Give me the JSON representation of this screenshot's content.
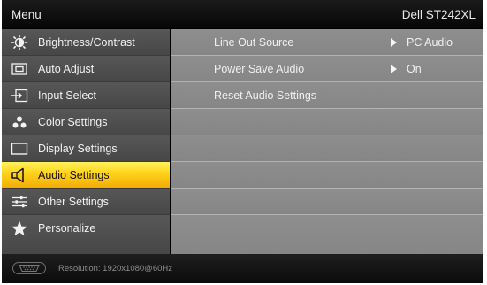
{
  "header": {
    "title": "Menu",
    "model": "Dell ST242XL"
  },
  "sidebar": {
    "items": [
      {
        "label": "Brightness/Contrast",
        "icon": "brightness-icon",
        "active": false
      },
      {
        "label": "Auto Adjust",
        "icon": "auto-adjust-icon",
        "active": false
      },
      {
        "label": "Input Select",
        "icon": "input-select-icon",
        "active": false
      },
      {
        "label": "Color Settings",
        "icon": "color-settings-icon",
        "active": false
      },
      {
        "label": "Display Settings",
        "icon": "display-settings-icon",
        "active": false
      },
      {
        "label": "Audio Settings",
        "icon": "speaker-icon",
        "active": true
      },
      {
        "label": "Other Settings",
        "icon": "other-settings-icon",
        "active": false
      },
      {
        "label": "Personalize",
        "icon": "star-icon",
        "active": false
      }
    ]
  },
  "content": {
    "rows": [
      {
        "label": "Line Out Source",
        "value": "PC Audio"
      },
      {
        "label": "Power Save Audio",
        "value": "On"
      },
      {
        "label": "Reset Audio Settings",
        "value": ""
      }
    ]
  },
  "footer": {
    "resolution": "Resolution:  1920x1080@60Hz",
    "input_icon": "vga-connector-icon"
  },
  "colors": {
    "highlight": "#ffd21a",
    "sidebar_bg": "#4d4d4d",
    "content_bg": "#8a8a8a"
  }
}
